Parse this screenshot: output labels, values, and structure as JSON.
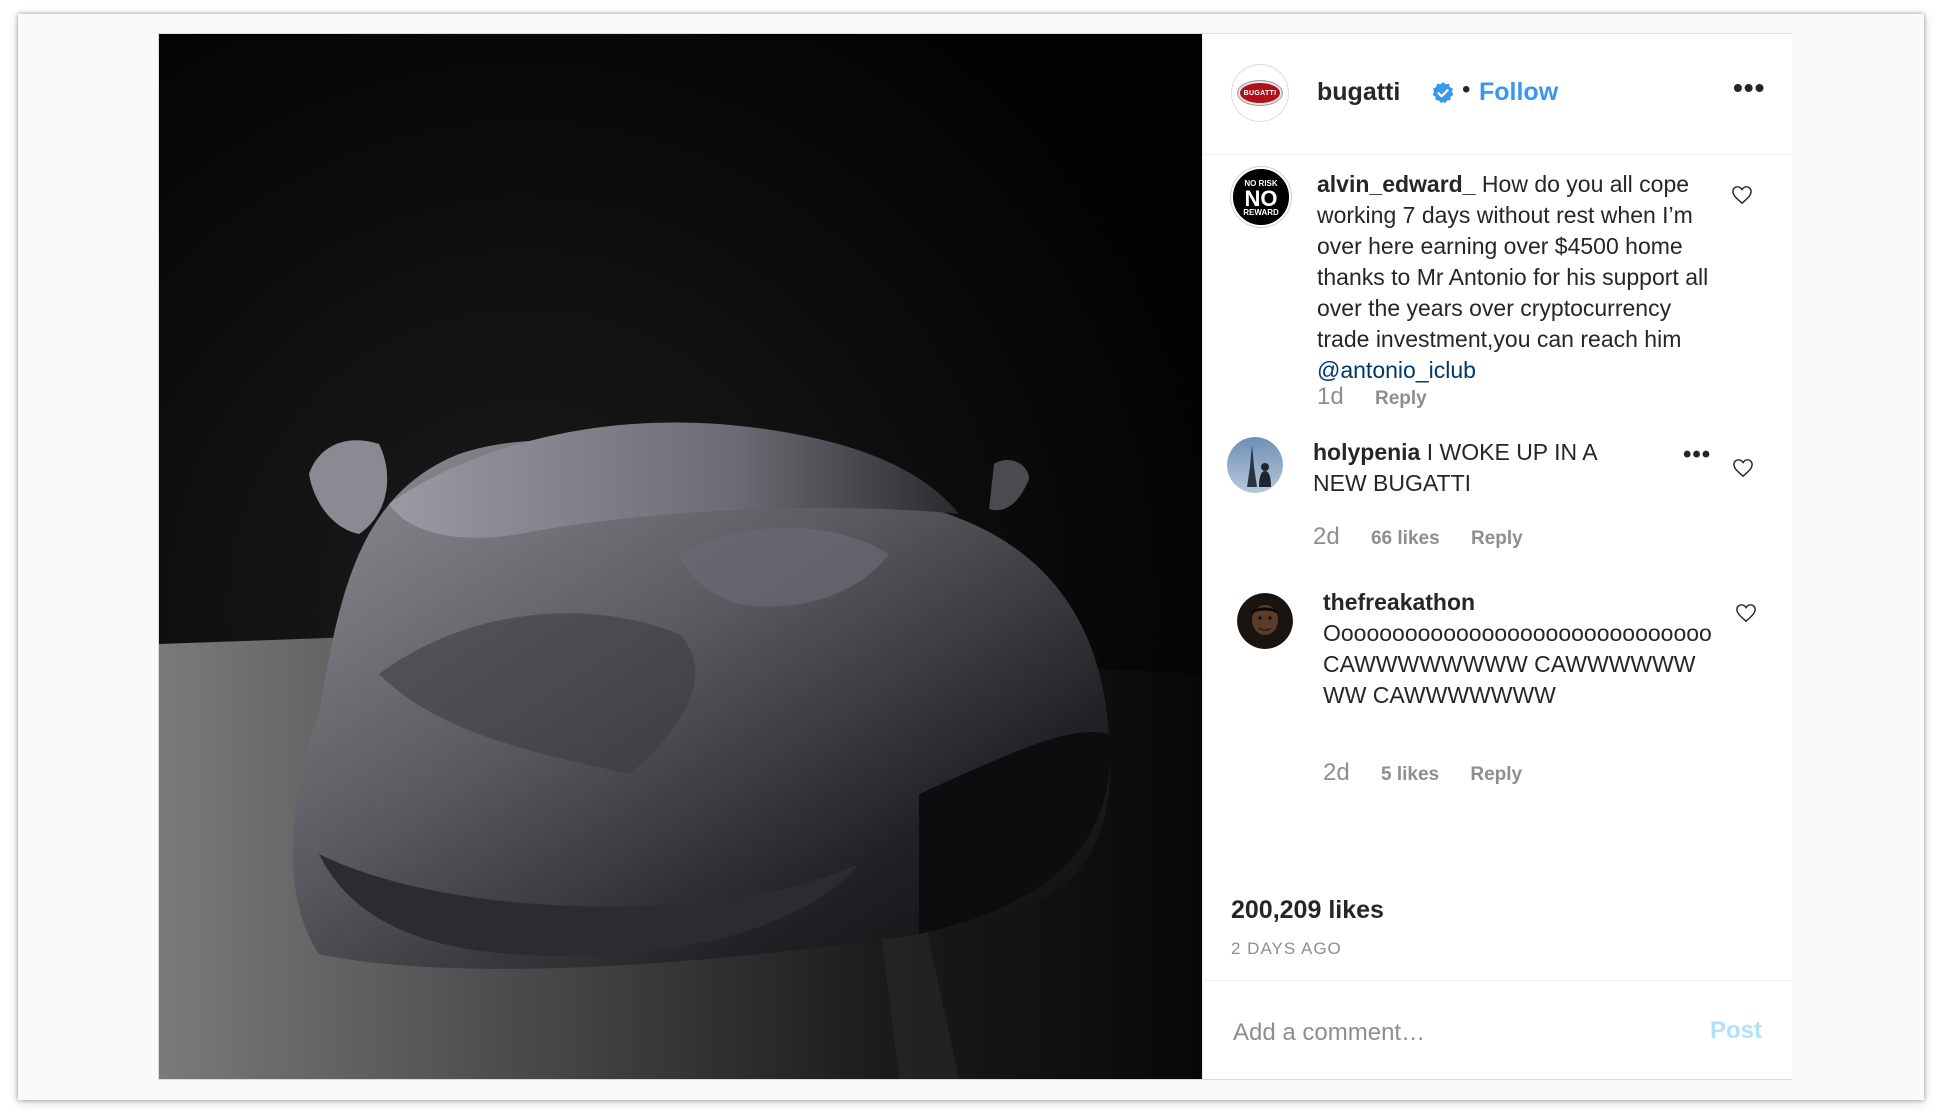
{
  "post": {
    "username": "bugatti",
    "verified": true,
    "follow_label": "Follow",
    "separator": "•",
    "more_glyph": "•••",
    "avatar_logo_text": "BUGATTI",
    "image_subject": "covered car"
  },
  "comments": [
    {
      "username": "alvin_edward_",
      "avatar": "no-risk-no-reward-badge",
      "avatar_text": {
        "top": "NO RISK",
        "middle": "NO",
        "bottom": "REWARD"
      },
      "text": "How do you all cope working 7 days without rest when I’m over here earning over $4500 home thanks to Mr Antonio for his support all over the years over cryptocurrency trade investment,you can reach him",
      "mention": "@antonio_iclub",
      "time": "1d",
      "likes": "",
      "reply_label": "Reply"
    },
    {
      "username": "holypenia",
      "avatar": "eiffel-tower-photo",
      "text": "I WOKE UP IN A NEW BUGATTI",
      "time": "2d",
      "likes": "66 likes",
      "reply_label": "Reply",
      "more_glyph": "•••"
    },
    {
      "username": "thefreakathon",
      "avatar": "face-photo",
      "text": "Oooooooooooooooooooooooooooooo CAWWWWWWWW CAWWWWWWWW CAWWWWWWW",
      "time": "2d",
      "likes": "5 likes",
      "reply_label": "Reply"
    }
  ],
  "likes_total": "200,209 likes",
  "posted": "2 DAYS AGO",
  "add_comment": {
    "placeholder": "Add a comment…",
    "post_label": "Post"
  },
  "colors": {
    "link": "#3897f0",
    "mention": "#00376b",
    "muted": "#8e8e8e",
    "post_disabled": "#b2dffc",
    "brand_red": "#b0111a"
  }
}
